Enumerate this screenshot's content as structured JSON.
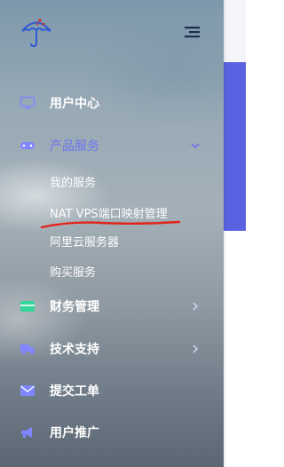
{
  "menu": {
    "items": [
      {
        "label": "用户中心",
        "icon": "monitor-icon"
      },
      {
        "label": "产品服务",
        "icon": "gamepad-icon",
        "expanded": true
      },
      {
        "label": "财务管理",
        "icon": "wallet-icon"
      },
      {
        "label": "技术支持",
        "icon": "truck-icon"
      },
      {
        "label": "提交工单",
        "icon": "envelope-icon"
      },
      {
        "label": "用户推广",
        "icon": "megaphone-icon"
      }
    ],
    "product_submenu": [
      {
        "label": "我的服务"
      },
      {
        "label": "NAT VPS端口映射管理"
      },
      {
        "label": "阿里云服务器"
      },
      {
        "label": "购买服务"
      }
    ]
  },
  "colors": {
    "accent": "#6f74f0",
    "icon_blue": "#7f86ff",
    "icon_green": "#35d49b",
    "annotation_red": "#e2231a"
  }
}
